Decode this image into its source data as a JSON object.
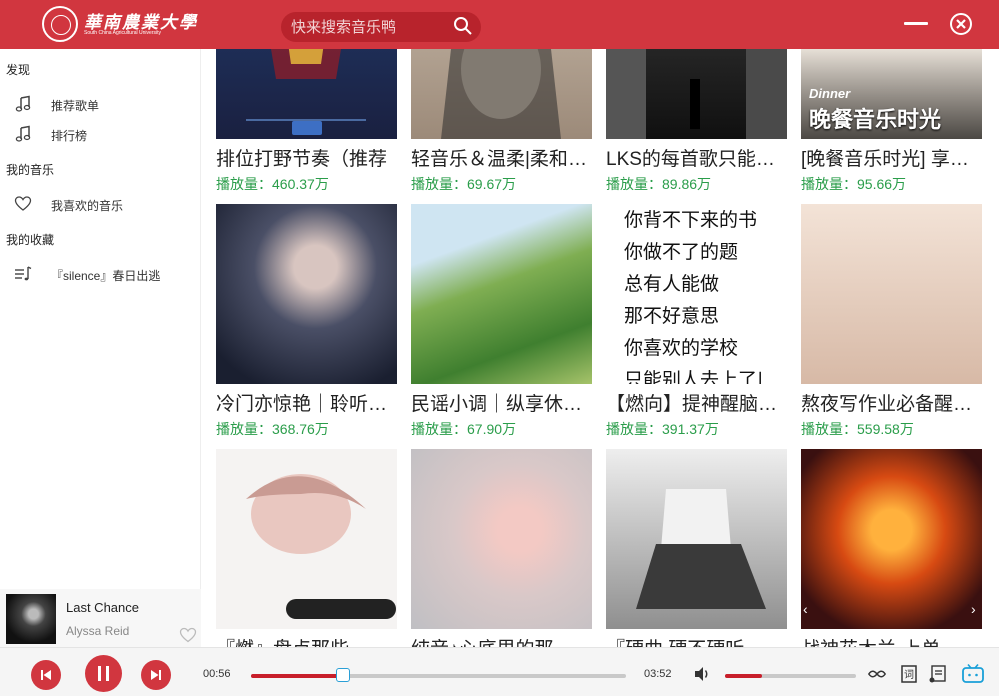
{
  "header": {
    "logo_cn": "華南農業大學",
    "logo_en": "South China Agricultural University",
    "search_placeholder": "快来搜索音乐鸭"
  },
  "sidebar": {
    "sections": [
      {
        "title": "发现",
        "items": [
          {
            "label": "推荐歌单",
            "icon": "music-note-icon"
          },
          {
            "label": "排行榜",
            "icon": "music-note-icon"
          }
        ]
      },
      {
        "title": "我的音乐",
        "items": [
          {
            "label": "我喜欢的音乐",
            "icon": "heart-icon"
          }
        ]
      },
      {
        "title": "我的收藏",
        "items": [
          {
            "label": "『silence』春日出逃",
            "icon": "playlist-icon"
          }
        ]
      }
    ]
  },
  "now_playing": {
    "song": "Last Chance",
    "artist": "Alyssa Reid"
  },
  "playlists": [
    {
      "title": "排位打野节奏（推荐",
      "plays_label": "播放量：",
      "plays": "460.37万"
    },
    {
      "title": "轻音乐＆温柔|柔和治愈",
      "plays_label": "播放量：",
      "plays": "69.67万"
    },
    {
      "title": "LKS的每首歌只能听一遍",
      "plays_label": "播放量：",
      "plays": "89.86万"
    },
    {
      "title": "[晚餐音乐时光] 享受美味",
      "plays_label": "播放量：",
      "plays": "95.66万",
      "thumb_en": "Dinner",
      "thumb_cn": "晚餐音乐时光"
    },
    {
      "title": "冷门亦惊艳｜聆听你的",
      "plays_label": "播放量：",
      "plays": "368.76万"
    },
    {
      "title": "民谣小调｜纵享休闲时光",
      "plays_label": "播放量：",
      "plays": "67.90万"
    },
    {
      "title": "【燃向】提神醒脑高燃",
      "plays_label": "播放量：",
      "plays": "391.37万",
      "thumb_lines": [
        "你背不下来的书",
        "你做不了的题",
        "总有人能做",
        "那不好意思",
        "你喜欢的学校",
        "只能别人去上了|"
      ]
    },
    {
      "title": "熬夜写作业必备醒脑神曲",
      "plays_label": "播放量：",
      "plays": "559.58万"
    },
    {
      "title": "『燃』盘点那些",
      "plays_label": "",
      "plays": ""
    },
    {
      "title": "纯音♪心底里的那",
      "plays_label": "",
      "plays": ""
    },
    {
      "title": "『硬曲 硬不硬听",
      "plays_label": "",
      "plays": ""
    },
    {
      "title": "战神花木兰-上单",
      "plays_label": "",
      "plays": ""
    }
  ],
  "player": {
    "current_time": "00:56",
    "total_time": "03:52",
    "progress": 0.246,
    "volume": 0.28
  },
  "colors": {
    "accent": "#d1363f",
    "plays_green": "#2a9d4a"
  }
}
